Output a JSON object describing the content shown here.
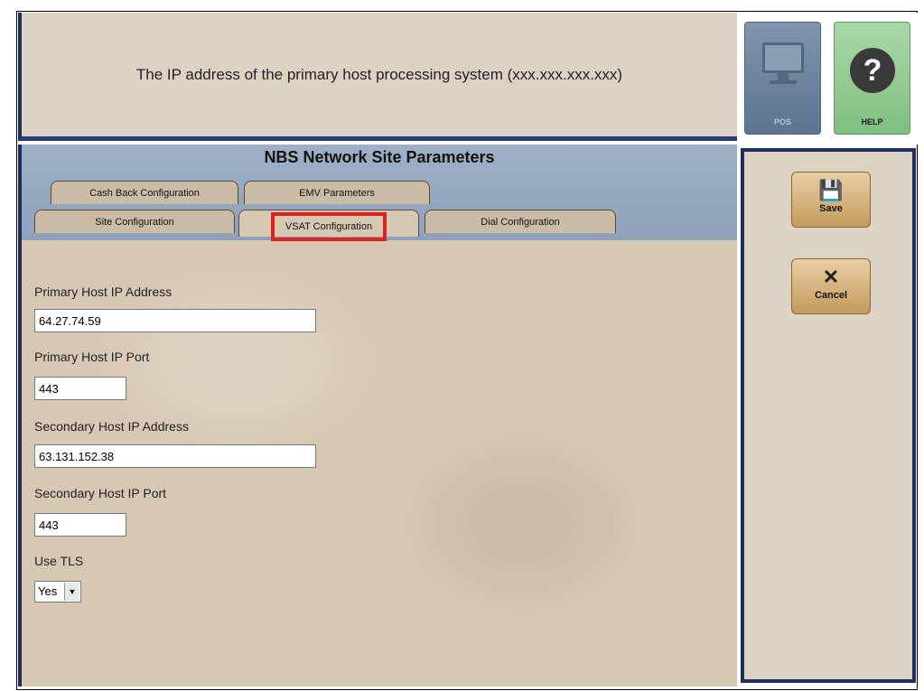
{
  "help_banner": {
    "text": "The IP address of the primary host processing system (xxx.xxx.xxx.xxx)"
  },
  "top_buttons": {
    "pos_label": "POS",
    "help_label": "HELP"
  },
  "screen": {
    "title": "NBS Network Site Parameters"
  },
  "tabs": {
    "row1": [
      "Cash Back Configuration",
      "EMV Parameters"
    ],
    "row2": [
      "Site Configuration",
      "VSAT Configuration",
      "Dial Configuration"
    ],
    "active": "VSAT Configuration",
    "highlight_color": "#e0201f"
  },
  "form": {
    "primary_ip": {
      "label": "Primary Host IP Address",
      "value": "64.27.74.59"
    },
    "primary_port": {
      "label": "Primary Host IP Port",
      "value": "443"
    },
    "secondary_ip": {
      "label": "Secondary Host IP Address",
      "value": "63.131.152.38"
    },
    "secondary_port": {
      "label": "Secondary Host IP Port",
      "value": "443"
    },
    "use_tls": {
      "label": "Use TLS",
      "value": "Yes"
    }
  },
  "side_buttons": {
    "save_label": "Save",
    "cancel_label": "Cancel"
  },
  "icons": {
    "pos": "monitor-icon",
    "help": "question-icon",
    "save": "floppy-icon",
    "cancel": "x-icon",
    "dropdown": "chevron-down-icon"
  }
}
